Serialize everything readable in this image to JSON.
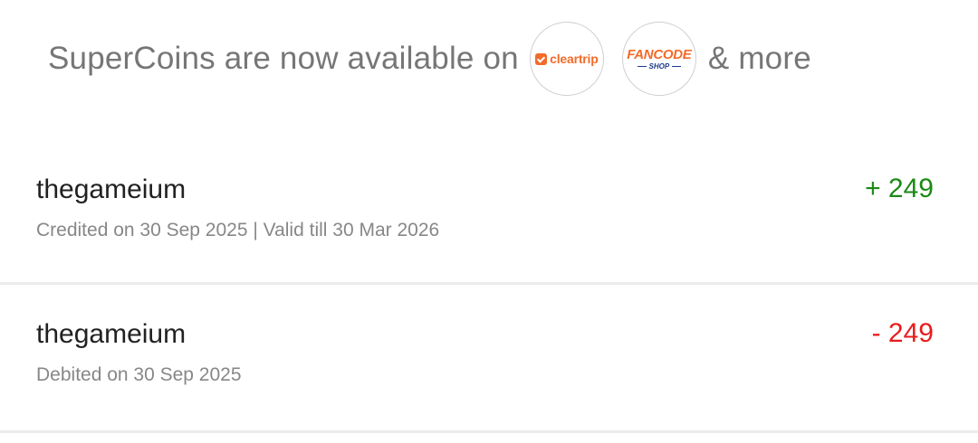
{
  "banner": {
    "text": "SuperCoins are now available on",
    "suffix": "& more",
    "partners": [
      {
        "name": "cleartrip",
        "icon": "cleartrip-logo"
      },
      {
        "name": "FANCODE",
        "sub": "SHOP",
        "icon": "fancode-shop-logo"
      }
    ]
  },
  "transactions": [
    {
      "title": "thegameium",
      "subtitle": "Credited on 30 Sep 2025 | Valid till 30 Mar 2026",
      "amount": "+ 249",
      "type": "credit"
    },
    {
      "title": "thegameium",
      "subtitle": "Debited on 30 Sep 2025",
      "amount": "- 249",
      "type": "debit"
    }
  ],
  "colors": {
    "credit": "#1b8a14",
    "debit": "#e81c1c",
    "partner_orange": "#f26b2a",
    "partner_navy": "#1a3a8a"
  }
}
